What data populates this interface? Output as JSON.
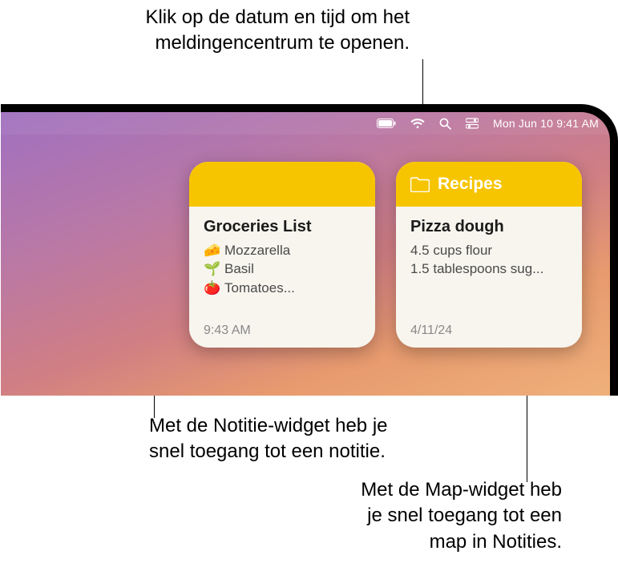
{
  "callouts": {
    "top": "Klik op de datum en tijd om het meldingencentrum te openen.",
    "mid_l1": "Met de Notitie-widget heb je",
    "mid_l2": "snel toegang tot een notitie.",
    "bot_l1": "Met de Map-widget heb",
    "bot_l2": "je snel toegang tot een",
    "bot_l3": "map in Notities."
  },
  "menubar": {
    "datetime": "Mon Jun 10  9:41 AM"
  },
  "widgets": {
    "note": {
      "title": "Groceries List",
      "items": [
        {
          "emoji": "🧀",
          "text": "Mozzarella"
        },
        {
          "emoji": "🌱",
          "text": "Basil"
        },
        {
          "emoji": "🍅",
          "text": "Tomatoes..."
        }
      ],
      "time": "9:43 AM"
    },
    "folder": {
      "name": "Recipes",
      "title": "Pizza dough",
      "lines": [
        "4.5 cups flour",
        "1.5 tablespoons sug..."
      ],
      "time": "4/11/24"
    }
  }
}
